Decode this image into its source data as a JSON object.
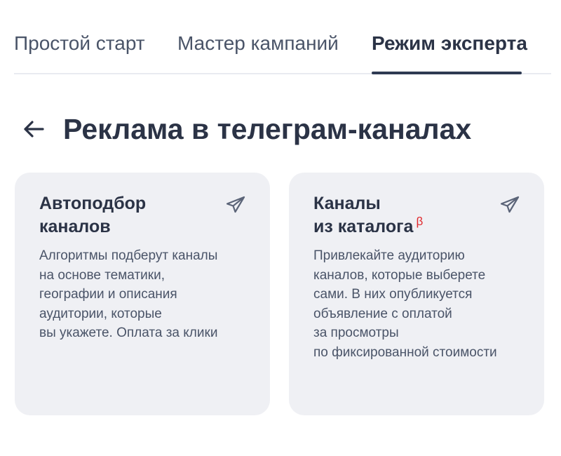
{
  "tabs": [
    {
      "label": "Простой старт"
    },
    {
      "label": "Мастер кампаний"
    },
    {
      "label": "Режим эксперта"
    }
  ],
  "active_tab": "Режим эксперта",
  "header": {
    "back_icon": "arrow-left-icon",
    "title": "Реклама в телеграм-каналах"
  },
  "cards": [
    {
      "title_lines": [
        "Автоподбор",
        "каналов"
      ],
      "description_lines": [
        "Алгоритмы подберут каналы",
        "на основе тематики,",
        "географии и описания",
        "аудитории, которые",
        "вы укажете. Оплата за клики"
      ],
      "icon": "telegram-icon"
    },
    {
      "title_lines": [
        "Каналы",
        "из каталога"
      ],
      "badge": "β",
      "description_lines": [
        "Привлекайте аудиторию",
        "каналов, которые выберете",
        "сами. В них опубликуется",
        "объявление с оплатой",
        "за просмотры",
        "по фиксированной стоимости"
      ],
      "icon": "telegram-icon"
    }
  ],
  "colors": {
    "text_primary": "#2b3346",
    "text_secondary": "#4a5468",
    "card_background": "#eff0f4",
    "beta_badge": "#e0262b",
    "icon_stroke": "#5b6478",
    "tab_underline": "#2e3a52"
  }
}
